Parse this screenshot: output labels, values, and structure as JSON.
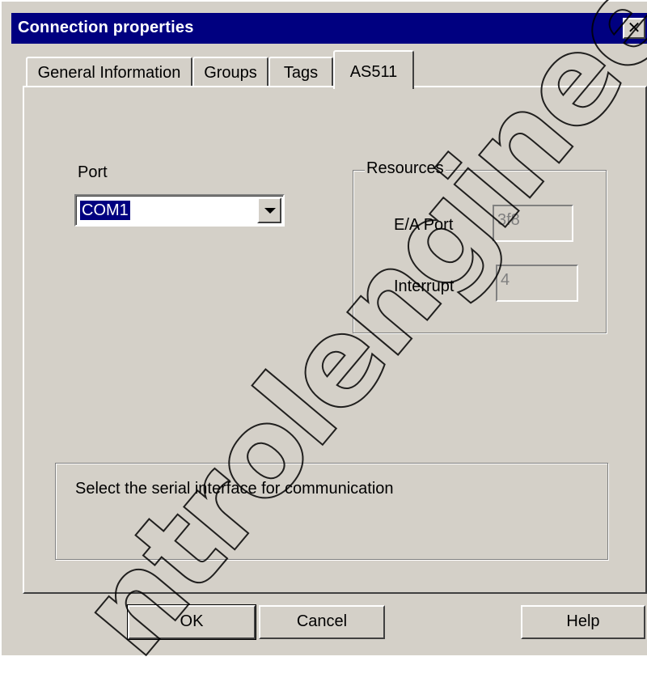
{
  "window": {
    "title": "Connection properties",
    "close_glyph": "✕"
  },
  "tabs": [
    {
      "label": "General Information"
    },
    {
      "label": "Groups"
    },
    {
      "label": "Tags"
    },
    {
      "label": "AS511"
    }
  ],
  "port": {
    "label": "Port",
    "value": "COM1"
  },
  "resources": {
    "title": "Resources",
    "ea_port_label": "E/A Port",
    "ea_port_value": "3f8",
    "interrupt_label": "Interrupt",
    "interrupt_value": "4"
  },
  "description": "Select the serial interface for communication",
  "buttons": {
    "ok": "OK",
    "cancel": "Cancel",
    "help": "Help"
  },
  "watermark": "ntrolengineer",
  "colors": {
    "titlebar": "#000080",
    "face": "#d4d0c8",
    "selection": "#000080"
  }
}
